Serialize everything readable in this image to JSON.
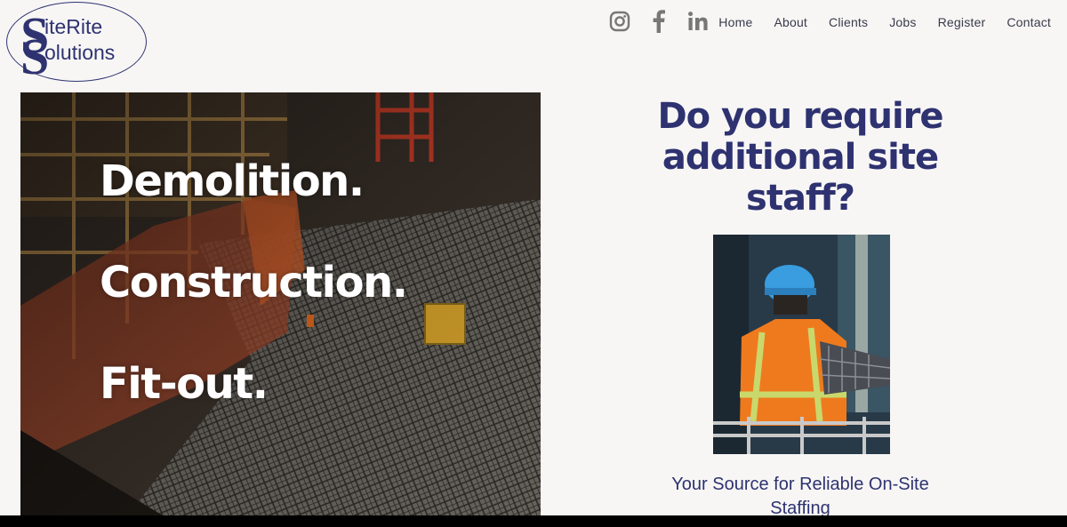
{
  "logo": {
    "line1": "iteRite",
    "line2": "olutions",
    "initial": "S"
  },
  "social": [
    "instagram-icon",
    "facebook-icon",
    "linkedin-icon"
  ],
  "nav": [
    "Home",
    "About",
    "Clients",
    "Jobs",
    "Register",
    "Contact"
  ],
  "hero": {
    "line1": "Demolition.",
    "line2": "Construction.",
    "line3": "Fit-out."
  },
  "headline": "Do you require additional site staff?",
  "tagline": "Your Source for Reliable On-Site Staffing",
  "colors": {
    "brand": "#2e3270",
    "background": "#f7f6f5"
  }
}
